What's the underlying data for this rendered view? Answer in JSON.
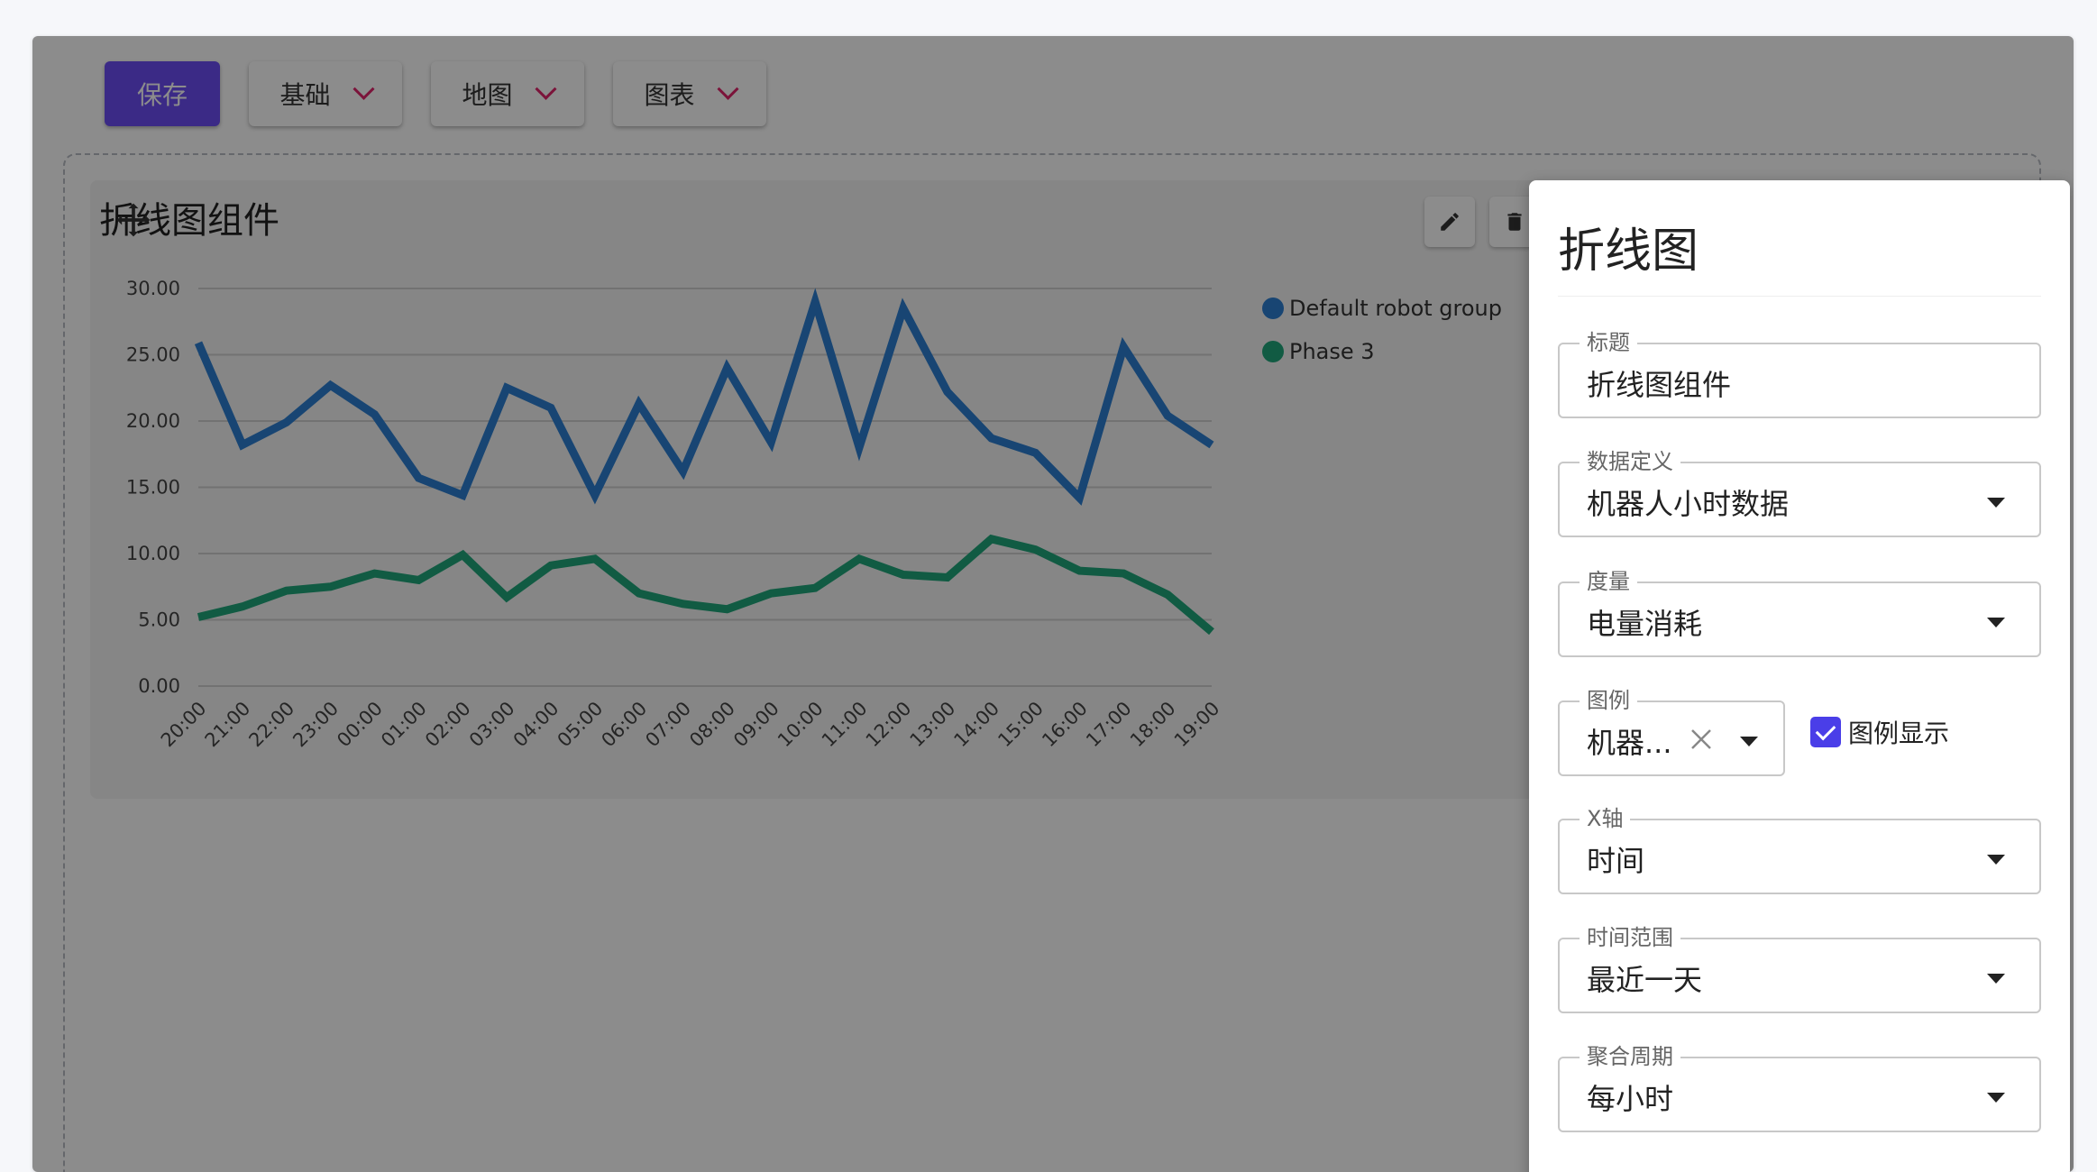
{
  "toolbar": {
    "save_label": "保存",
    "menus": [
      {
        "label": "基础"
      },
      {
        "label": "地图"
      },
      {
        "label": "图表"
      }
    ]
  },
  "widget": {
    "title": "折线图组件"
  },
  "colors": {
    "series_blue": "#2c7fd1",
    "series_green": "#1fa67a",
    "accent": "#6c4df5"
  },
  "chart_data": {
    "type": "line",
    "x": [
      "20:00",
      "21:00",
      "22:00",
      "23:00",
      "00:00",
      "01:00",
      "02:00",
      "03:00",
      "04:00",
      "05:00",
      "06:00",
      "07:00",
      "08:00",
      "09:00",
      "10:00",
      "11:00",
      "12:00",
      "13:00",
      "14:00",
      "15:00",
      "16:00",
      "17:00",
      "18:00",
      "19:00"
    ],
    "series": [
      {
        "name": "Default robot group",
        "color": "#2c7fd1",
        "values": [
          25.9,
          18.2,
          19.9,
          22.7,
          20.5,
          15.7,
          14.4,
          22.5,
          21.0,
          14.4,
          21.3,
          16.2,
          24.0,
          18.4,
          29.0,
          18.0,
          28.5,
          22.2,
          18.7,
          17.6,
          14.2,
          25.6,
          20.4,
          18.2
        ]
      },
      {
        "name": "Phase 3",
        "color": "#1fa67a",
        "values": [
          5.2,
          6.0,
          7.2,
          7.5,
          8.5,
          8.0,
          9.9,
          6.7,
          9.1,
          9.6,
          7.0,
          6.2,
          5.8,
          7.0,
          7.4,
          9.6,
          8.4,
          8.2,
          11.1,
          10.3,
          8.7,
          8.5,
          6.9,
          4.1
        ]
      }
    ],
    "yticks": [
      "0.00",
      "5.00",
      "10.00",
      "15.00",
      "20.00",
      "25.00",
      "30.00"
    ],
    "ylim": [
      0,
      30
    ],
    "grid": true,
    "legend": "right"
  },
  "panel": {
    "title": "折线图",
    "fields": [
      {
        "label": "标题",
        "value": "折线图组件"
      },
      {
        "label": "数据定义",
        "value": "机器人小时数据"
      },
      {
        "label": "度量",
        "value": "电量消耗"
      },
      {
        "label": "图例",
        "value": "机器..."
      },
      {
        "label": "X轴",
        "value": "时间"
      },
      {
        "label": "时间范围",
        "value": "最近一天"
      },
      {
        "label": "聚合周期",
        "value": "每小时"
      }
    ],
    "legend_toggle_label": "图例显示",
    "legend_toggle_checked": true
  }
}
